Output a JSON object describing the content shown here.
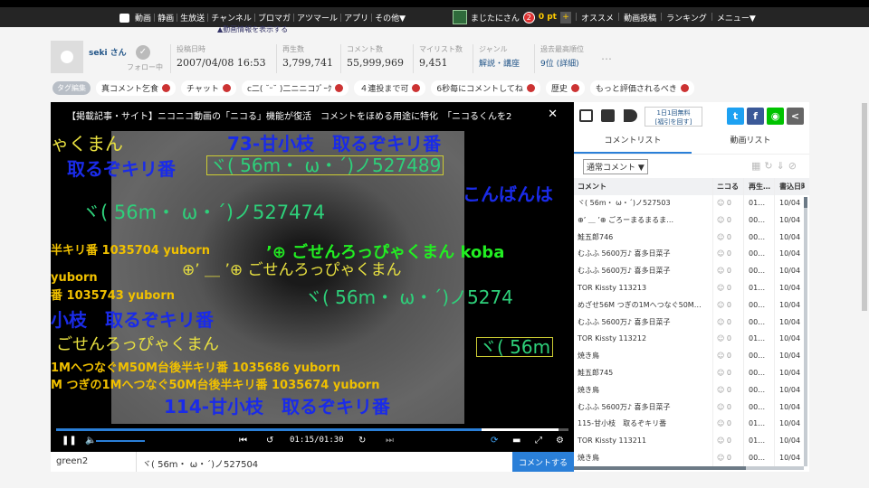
{
  "nav": {
    "left": [
      "動画",
      "静画",
      "生放送",
      "チャンネル",
      "ブロマガ",
      "アツマール",
      "アプリ",
      "その他▼"
    ],
    "user": "まじたにさん",
    "notif": "2",
    "points": "0 pt",
    "right": [
      "オススメ",
      "動画投稿",
      "ランキング",
      "メニュー▼"
    ]
  },
  "sub_link": "▲動画情報を表示する",
  "info": {
    "uploader": "seki さん",
    "follow": "フォロー中",
    "posted_label": "投稿日時",
    "posted": "2007/04/08 16:53",
    "views_label": "再生数",
    "views": "3,799,741",
    "comments_label": "コメント数",
    "comments": "55,999,969",
    "mylist_label": "マイリスト数",
    "mylist": "9,451",
    "genre_label": "ジャンル",
    "genre": "解説・講座",
    "rank_label": "過去最高順位",
    "rank": "9位 (詳細)",
    "more": "…"
  },
  "tags": {
    "edit": "タグ編集",
    "items": [
      "真コメント乞食",
      "チャット",
      "ⅽ二( ˘ᵕ˘ )二ニニコﾌﾞｰｸ",
      "４連投まで可",
      "6秒毎にコメントしてね",
      "歴史",
      "もっと評価されるべき"
    ]
  },
  "player": {
    "title": "【掲載記事・サイト】ニコニコ動画の「ニコる」機能が復活　コメントをほめる用途に特化　「ニコるくんを2",
    "time": "01:15/01:30",
    "progress": 0.83,
    "buffered": 0.98,
    "volume": 0.6,
    "comments": [
      "ゃくまん",
      "73-甘小枝　取るぞキリ番",
      "取るぞキリ番",
      "ヾ( 56m・ ω・´)ノ527489",
      "こんばんは",
      "ヾ( 56m・ ω・´)ノ527474",
      "半キリ番 1035704 yuborn",
      "’⊕ ごせんろっぴゃくまん koba",
      "⊕’ ＿ ’⊕ ごせんろっぴゃくまん",
      "yuborn",
      "番 1035743 yuborn",
      "ヾ( 56m・ ω・´)ノ5274",
      "小枝　取るぞキリ番",
      "ごせんろっぴゃくまん",
      "ヾ( 56m",
      "1MへつなぐM50M台後半キリ番 1035686 yuborn",
      "M つぎの1Mへつなぐ50M台後半キリ番 1035674 yuborn",
      "114-甘小枝　取るぞキリ番"
    ]
  },
  "input": {
    "command": "green2",
    "text": "ヾ( 56m・ ω・´)ノ527504",
    "send": "コメントする"
  },
  "panel": {
    "promo": "1日1回無料\n[福引を回す]",
    "tabs": [
      "コメントリスト",
      "動画リスト"
    ],
    "filter": "通常コメント ▼",
    "headers": [
      "コメント",
      "ニコる",
      "再生…",
      "書込日時"
    ],
    "rows": [
      [
        "ヾ( 56m・ ω・´)ノ527503",
        "0",
        "01…",
        "10/04"
      ],
      [
        "⊕’ ＿ ’⊕ ごろーまるまるま…",
        "0",
        "00…",
        "10/04"
      ],
      [
        "鮭五郎746",
        "0",
        "00…",
        "10/04"
      ],
      [
        "むふふ 5600万♪ 喜多日菜子",
        "0",
        "00…",
        "10/04"
      ],
      [
        "むふふ 5600万♪ 喜多日菜子",
        "0",
        "00…",
        "10/04"
      ],
      [
        "TOR Kissty 113213",
        "0",
        "01…",
        "10/04"
      ],
      [
        "めざせ56M つぎの1Mへつなぐ50M…",
        "0",
        "00…",
        "10/04"
      ],
      [
        "むふふ 5600万♪ 喜多日菜子",
        "0",
        "00…",
        "10/04"
      ],
      [
        "TOR Kissty 113212",
        "0",
        "01…",
        "10/04"
      ],
      [
        "焼き鳥",
        "0",
        "00…",
        "10/04"
      ],
      [
        "鮭五郎745",
        "0",
        "00…",
        "10/04"
      ],
      [
        "焼き鳥",
        "0",
        "00…",
        "10/04"
      ],
      [
        "むふふ 5600万♪ 喜多日菜子",
        "0",
        "00…",
        "10/04"
      ],
      [
        "115-甘小枝　取るぞキリ番",
        "0",
        "01…",
        "10/04"
      ],
      [
        "TOR Kissty 113211",
        "0",
        "01…",
        "10/04"
      ],
      [
        "焼き鳥",
        "0",
        "00…",
        "10/04"
      ]
    ]
  }
}
